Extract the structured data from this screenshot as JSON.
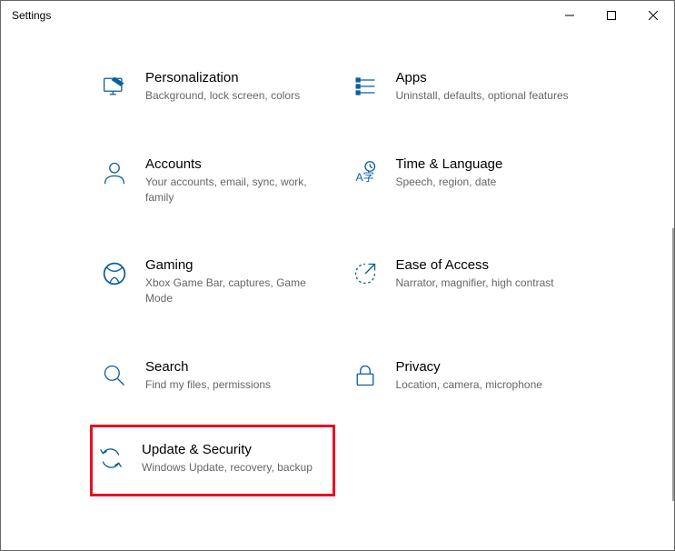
{
  "window": {
    "title": "Settings"
  },
  "categories": [
    {
      "id": "personalization",
      "title": "Personalization",
      "desc": "Background, lock screen, colors"
    },
    {
      "id": "apps",
      "title": "Apps",
      "desc": "Uninstall, defaults, optional features"
    },
    {
      "id": "accounts",
      "title": "Accounts",
      "desc": "Your accounts, email, sync, work, family"
    },
    {
      "id": "time-language",
      "title": "Time & Language",
      "desc": "Speech, region, date"
    },
    {
      "id": "gaming",
      "title": "Gaming",
      "desc": "Xbox Game Bar, captures, Game Mode"
    },
    {
      "id": "ease-of-access",
      "title": "Ease of Access",
      "desc": "Narrator, magnifier, high contrast"
    },
    {
      "id": "search",
      "title": "Search",
      "desc": "Find my files, permissions"
    },
    {
      "id": "privacy",
      "title": "Privacy",
      "desc": "Location, camera, microphone"
    },
    {
      "id": "update-security",
      "title": "Update & Security",
      "desc": "Windows Update, recovery, backup"
    }
  ]
}
